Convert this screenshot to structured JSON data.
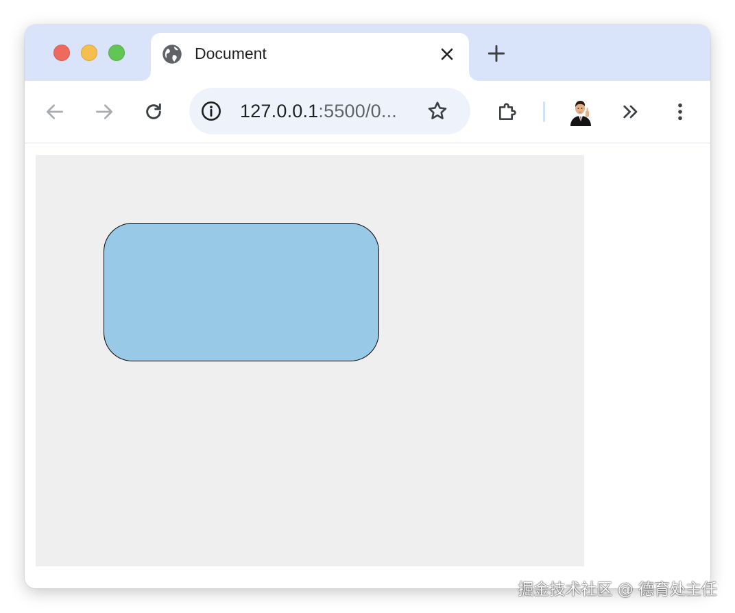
{
  "browser": {
    "tab": {
      "title": "Document",
      "favicon": "globe-icon"
    },
    "controls": {
      "close_icon": "close-icon",
      "new_tab_icon": "plus-icon",
      "window_buttons": [
        "close",
        "minimize",
        "maximize"
      ]
    },
    "toolbar": {
      "back_icon": "arrow-left-icon",
      "forward_icon": "arrow-right-icon",
      "reload_icon": "reload-icon",
      "site_info_icon": "info-icon",
      "bookmark_icon": "star-icon",
      "extensions_icon": "puzzle-icon",
      "overflow_icon": "chevrons-right-icon",
      "menu_icon": "kebab-menu-icon",
      "url_host": "127.0.0.1",
      "url_rest": ":5500/0..."
    }
  },
  "page": {
    "background_color": "#efefef",
    "shape": {
      "type": "rounded-rectangle",
      "fill": "#98cae8",
      "stroke": "#000000"
    }
  },
  "watermark": "掘金技术社区 @ 德育处主任",
  "colors": {
    "tabstrip": "#d9e4fb",
    "omnibox": "#eef2fb",
    "traffic_red": "#ee6a5f",
    "traffic_yellow": "#f5bf4f",
    "traffic_green": "#62c655"
  }
}
